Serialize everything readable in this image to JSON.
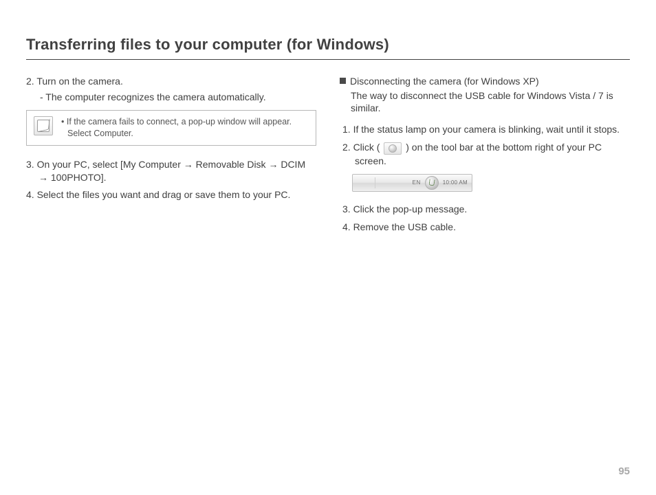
{
  "title": "Transferring files to your computer (for Windows)",
  "page_number": "95",
  "left": {
    "step2": "2. Turn on the camera.",
    "step2_sub": "- The computer recognizes the camera automatically.",
    "tip_bullet": "• If the camera fails to connect, a pop-up window will appear. Select Computer.",
    "step3": "3. On your PC, select [My Computer → Removable Disk → DCIM → 100PHOTO].",
    "step4": "4. Select the files you want and drag or save them to your PC."
  },
  "right": {
    "section_title": "Disconnecting the camera (for Windows XP)",
    "section_desc": "The way to disconnect the USB cable for Windows Vista / 7 is similar.",
    "step1": "1. If the status lamp on your camera is blinking, wait until it stops.",
    "step2_a": "2. Click (",
    "step2_b": ") on the tool bar at the bottom right of your PC screen.",
    "taskbar_en": "EN",
    "taskbar_time": "10:00 AM",
    "step3": "3. Click the pop-up message.",
    "step4": "4. Remove the USB cable."
  }
}
